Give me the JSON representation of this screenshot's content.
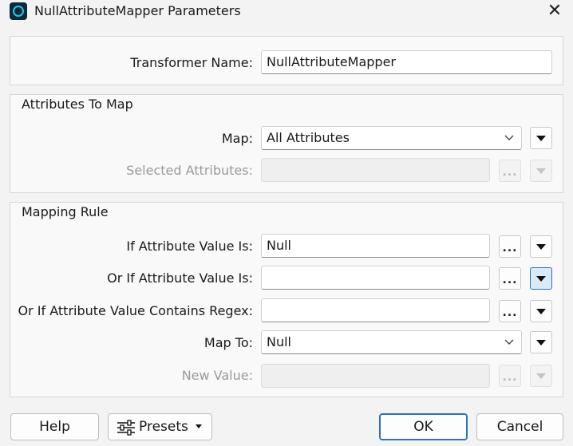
{
  "window": {
    "title": "NullAttributeMapper Parameters",
    "close_glyph": "✕"
  },
  "transformer": {
    "label": "Transformer Name:",
    "value": "NullAttributeMapper"
  },
  "attributes_to_map": {
    "title": "Attributes To Map",
    "map_label": "Map:",
    "map_value": "All Attributes",
    "selected_label": "Selected Attributes:",
    "selected_value": ""
  },
  "mapping_rule": {
    "title": "Mapping Rule",
    "if_value_label": "If Attribute Value Is:",
    "if_value": "Null",
    "or_if_value_label": "Or If Attribute Value Is:",
    "or_if_value": "",
    "regex_label": "Or If Attribute Value Contains Regex:",
    "regex_value": "",
    "map_to_label": "Map To:",
    "map_to_value": "Null",
    "new_value_label": "New Value:",
    "new_value": ""
  },
  "buttons": {
    "ellipsis": "...",
    "help": "Help",
    "presets": "Presets",
    "ok": "OK",
    "cancel": "Cancel"
  },
  "icons": {
    "app": "fme-app-icon",
    "close": "close-icon",
    "dropdown": "chevron-down-icon",
    "menu": "triangle-down-icon",
    "presets": "sliders-icon"
  },
  "colors": {
    "accent": "#2a72b8",
    "active_fill": "#dbeaf7",
    "disabled_text": "#9a9a9a",
    "app_icon_ring": "#27c5e6"
  }
}
